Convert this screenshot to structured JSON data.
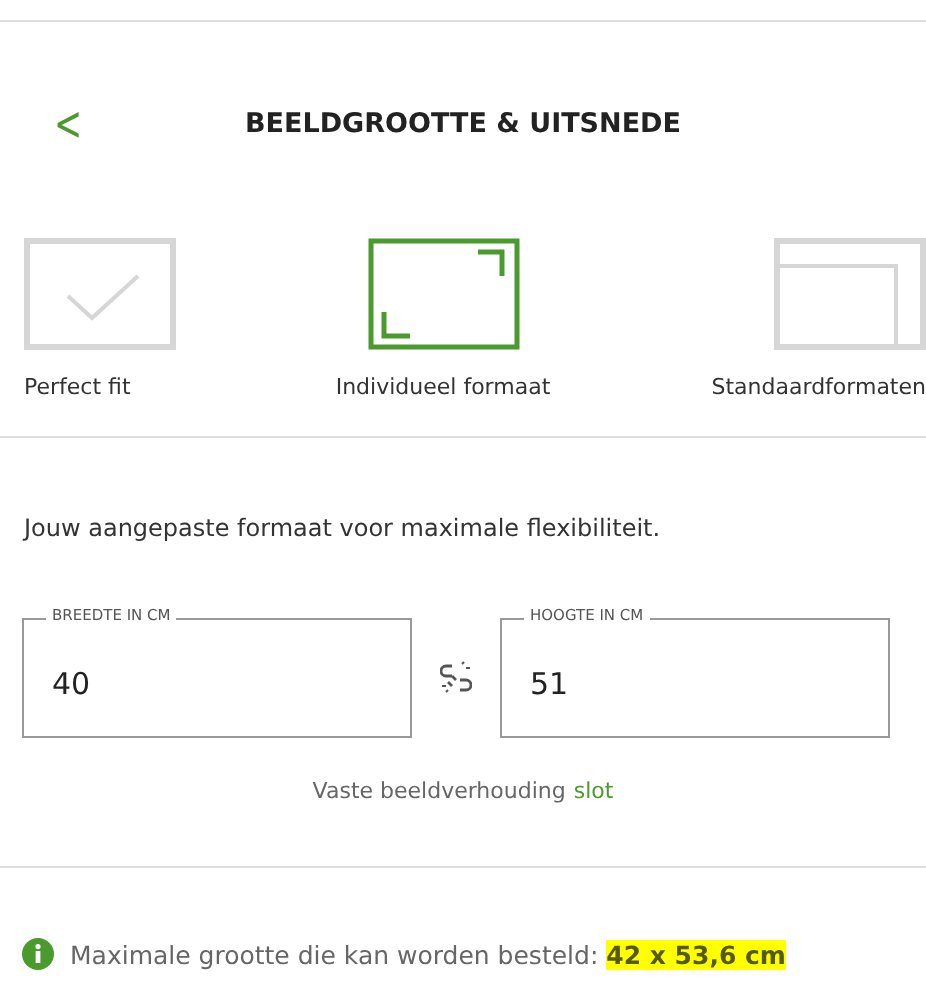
{
  "header": {
    "back": "<",
    "title": "BEELDGROOTTE & UITSNEDE"
  },
  "options": [
    {
      "kind": "check",
      "label": "Perfect fit",
      "selected": false
    },
    {
      "kind": "corners",
      "label": "Individueel formaat",
      "selected": true
    },
    {
      "kind": "frames",
      "label": "Standaardformaten",
      "selected": false
    }
  ],
  "description": "Jouw aangepaste formaat voor maximale flexibiliteit.",
  "fields": [
    {
      "label": "BREEDTE IN CM",
      "value": "40"
    },
    {
      "label": "HOOGTE IN CM",
      "value": "51"
    }
  ],
  "aspect": {
    "label": "Vaste beeldverhouding",
    "link": "slot"
  },
  "info": "Maximale grootte die kan worden besteld: **42 x 53,6 cm**"
}
